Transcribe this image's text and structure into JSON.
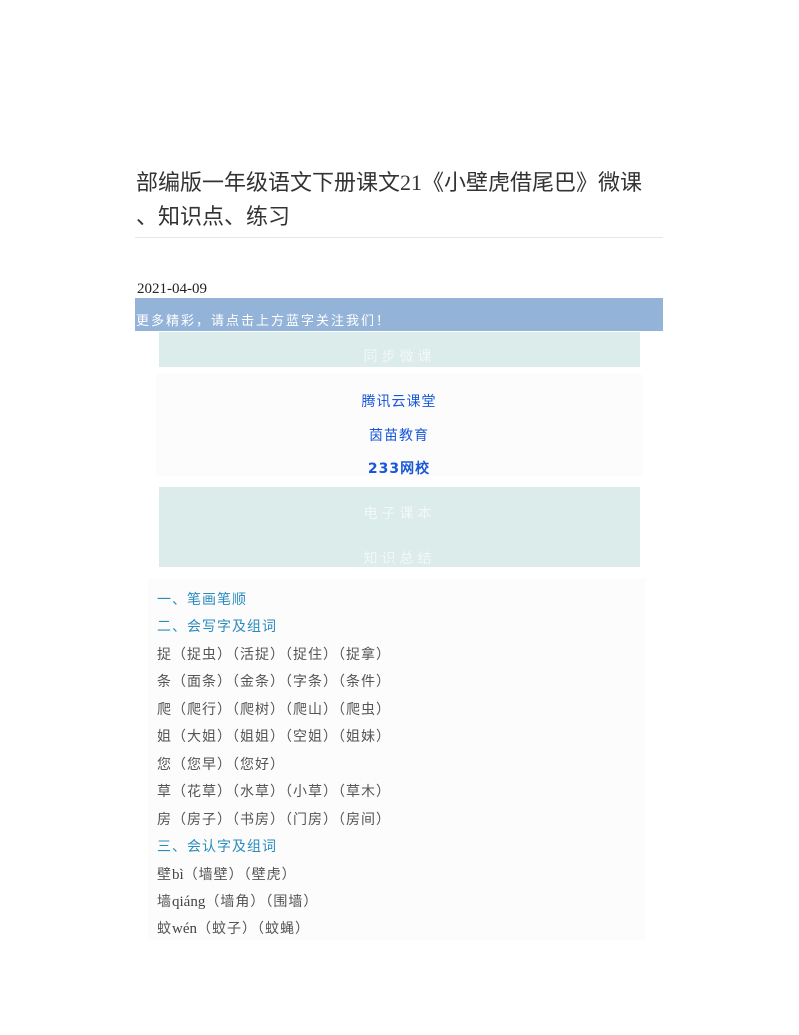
{
  "article": {
    "title": "部编版一年级语文下册课文21《小壁虎借尾巴》微课、知识点、练习",
    "title_line1": "部编版一年级语文下册课文21《小壁虎借尾巴》微课",
    "title_line2": "、知识点、练习",
    "date": "2021-04-09",
    "follow_prompt": "更多精彩，请点击上方蓝字关注我们！"
  },
  "sections": {
    "micro_lesson_label": "同步微课",
    "links": [
      "腾讯云课堂",
      "茵苗教育",
      "233网校"
    ],
    "ebook_label": "电子课本",
    "summary_label": "知识总结"
  },
  "colors": {
    "follow_bar": "#94b3d8",
    "section_box": "#dcecea",
    "link": "#1a57d8",
    "heading": "#2a8bbf"
  },
  "knowledge": {
    "headings": [
      "一、笔画笔顺",
      "二、会写字及组词",
      "三、会认字及组词"
    ],
    "write_words": [
      "捉（捉虫）（活捉）（捉住）（捉拿）",
      "条（面条）（金条）（字条）（条件）",
      "爬（爬行）（爬树）（爬山）（爬虫）",
      "姐（大姐）（姐姐）（空姐）（姐妹）",
      "您（您早）（您好）",
      "草（花草）（水草）（小草）（草木）",
      "房（房子）（书房）（门房）（房间）"
    ],
    "read_words": [
      {
        "char": "壁",
        "pinyin": "bì",
        "words": "（墙壁）（壁虎）"
      },
      {
        "char": "墙",
        "pinyin": "qiáng",
        "words": "（墙角）（围墙）"
      },
      {
        "char": "蚊",
        "pinyin": "wén",
        "words": "（蚊子）（蚊蝇）"
      }
    ]
  }
}
